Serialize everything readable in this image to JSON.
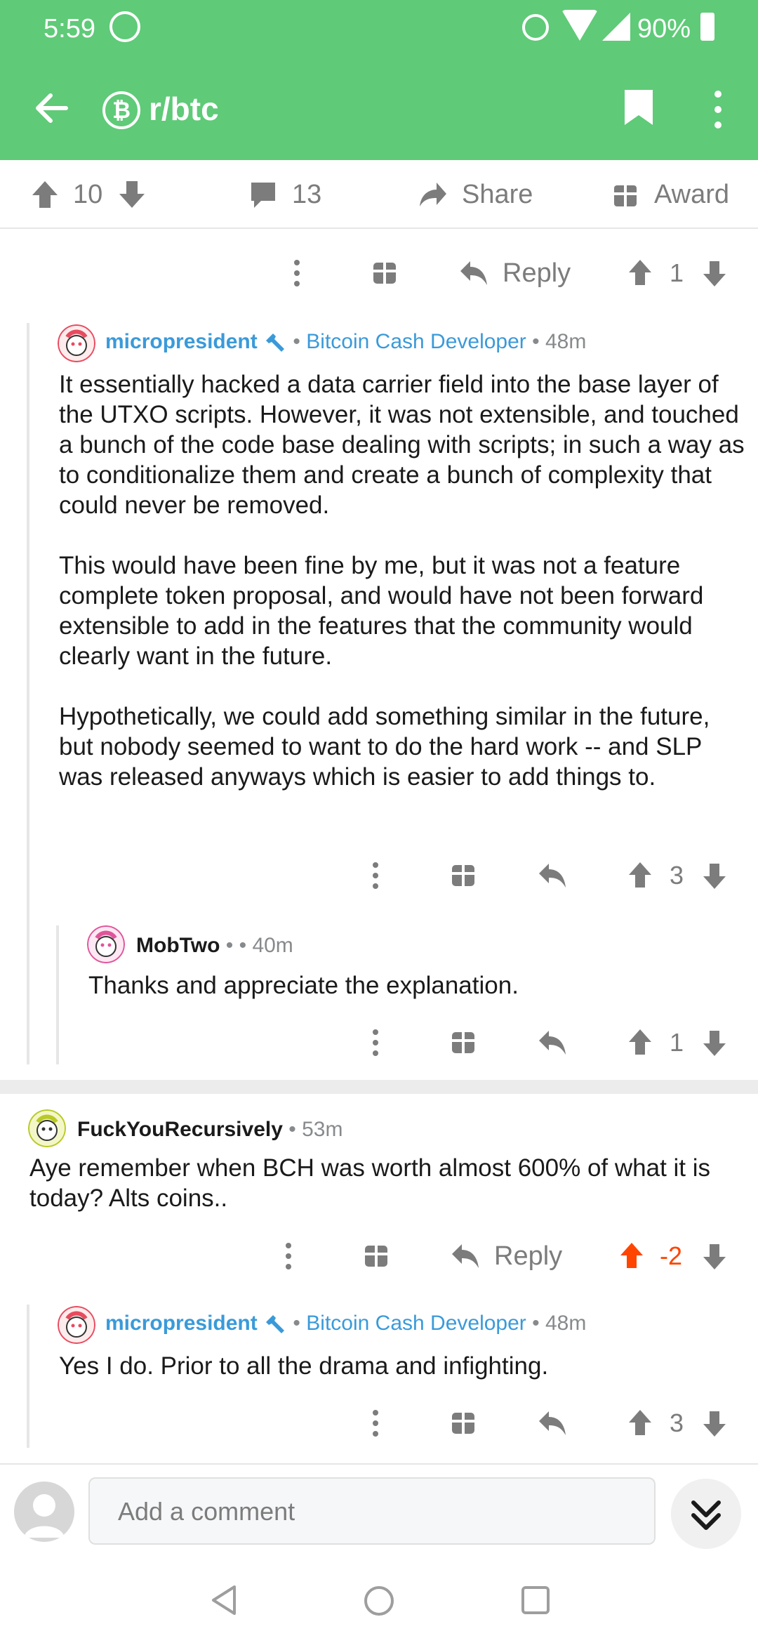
{
  "status_bar": {
    "time": "5:59",
    "battery": "90%"
  },
  "app_bar": {
    "subreddit": "r/btc",
    "sub_icon": "₿"
  },
  "post_actions": {
    "upvotes": "10",
    "comments": "13",
    "share": "Share",
    "award": "Award"
  },
  "top_row": {
    "reply": "Reply",
    "score": "1"
  },
  "comments": [
    {
      "author": "micropresident",
      "flair": "Bitcoin Cash Developer",
      "time": "48m",
      "paragraphs": [
        "It essentially hacked a data carrier field into the base layer of the UTXO scripts. However, it was not extensible, and touched a bunch of the code base dealing with scripts; in such a way as to conditionalize them and create a bunch of complexity that could never be removed.",
        "This would have been fine by me, but it was not a feature complete token proposal, and would have not been forward extensible to add in the features that the community would clearly want in the future.",
        "Hypothetically, we could add something similar in the future, but nobody seemed to want to do the hard work -- and SLP was released anyways which is easier to add things to."
      ],
      "score": "3"
    },
    {
      "author": "MobTwo",
      "time": "40m",
      "body": "Thanks and appreciate the explanation.",
      "score": "1"
    },
    {
      "author": "FuckYouRecursively",
      "time": "53m",
      "body": "Aye remember when BCH was worth almost 600% of what it is today? Alts coins..",
      "reply": "Reply",
      "score": "-2"
    },
    {
      "author": "micropresident",
      "flair": "Bitcoin Cash Developer",
      "time": "48m",
      "body": "Yes I do. Prior to all the drama and infighting.",
      "score": "3"
    }
  ],
  "composer": {
    "placeholder": "Add a comment"
  },
  "colors": {
    "brand_green": "#5fca78",
    "op_blue": "#3a9ad9",
    "upvote_orange": "#ff4500",
    "muted": "#7c7c7c"
  },
  "icons": [
    "back-arrow-icon",
    "bitcoin-icon",
    "bookmark-icon",
    "kebab-icon",
    "upvote-icon",
    "downvote-icon",
    "comment-icon",
    "share-icon",
    "gift-icon",
    "reply-icon",
    "wrench-icon",
    "chevrons-down-icon"
  ]
}
